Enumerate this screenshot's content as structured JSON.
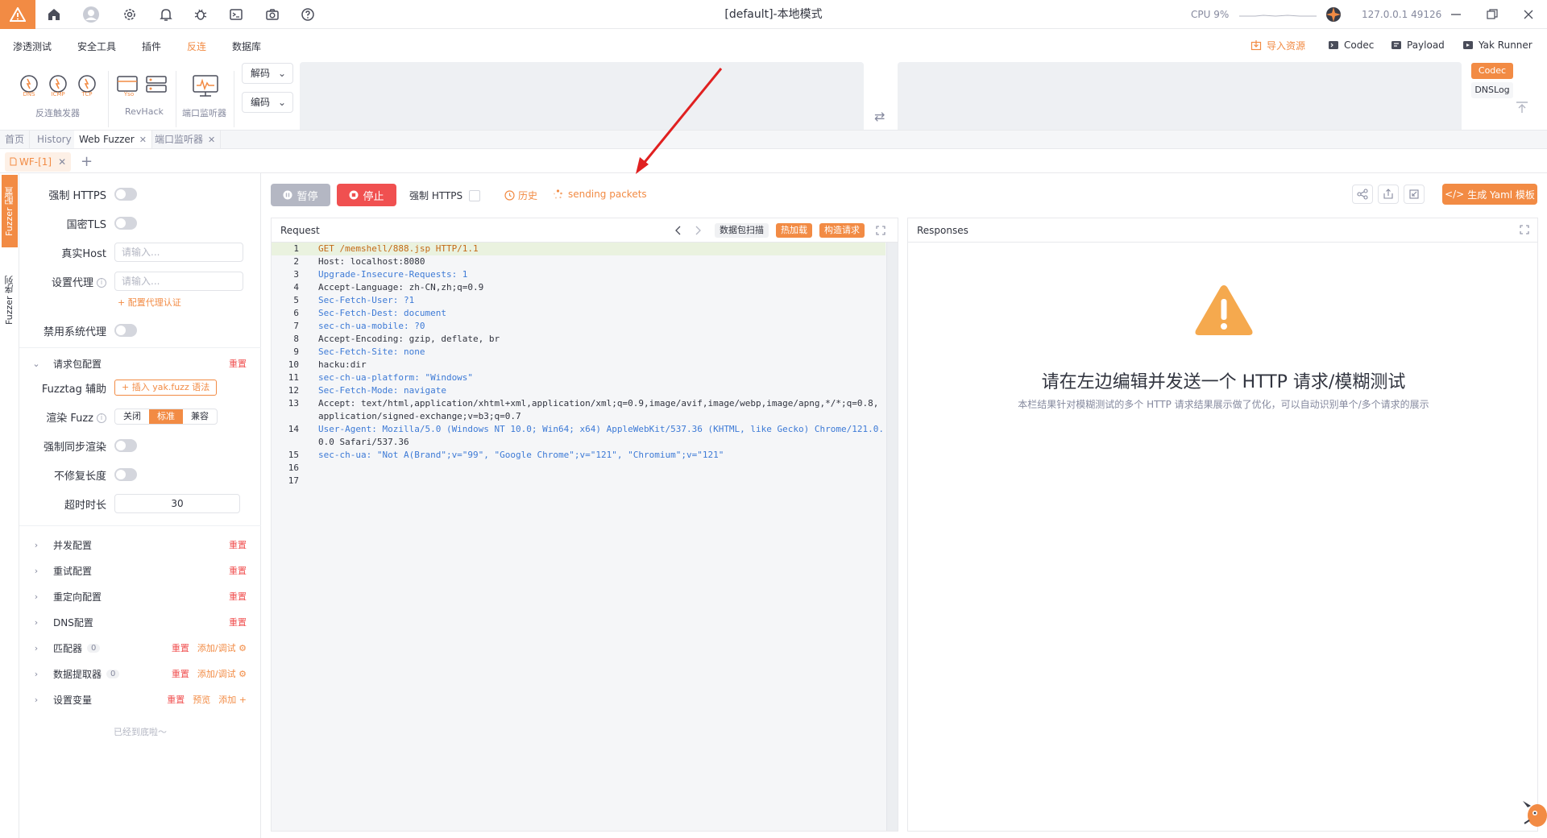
{
  "title_bar": {
    "window_title": "[default]-本地模式",
    "cpu_label": "CPU 9%",
    "address": "127.0.0.1 49126",
    "nav_icons": [
      "home-icon",
      "user-icon",
      "settings-icon",
      "bell-icon",
      "bug-icon",
      "terminal-icon",
      "camera-icon",
      "help-icon"
    ]
  },
  "menu": {
    "items": [
      "渗透测试",
      "安全工具",
      "插件",
      "反连",
      "数据库"
    ],
    "active": "反连",
    "right": {
      "import": "导入资源",
      "codec": "Codec",
      "payload": "Payload",
      "yak_runner": "Yak Runner"
    }
  },
  "tools": {
    "reverse_trigger": {
      "label": "反连触发器",
      "icons": [
        "DNS",
        "ICMP",
        "TCP"
      ]
    },
    "revhack": {
      "label": "RevHack"
    },
    "port_monitor": {
      "label": "端口监听器"
    },
    "decode": "解码",
    "encode": "编码",
    "right_tabs": [
      "Codec",
      "DNSLog"
    ]
  },
  "page_tabs": [
    {
      "label": "首页",
      "closable": false
    },
    {
      "label": "History",
      "closable": false
    },
    {
      "label": "Web Fuzzer",
      "closable": true,
      "active": true
    },
    {
      "label": "端口监听器",
      "closable": true
    }
  ],
  "sub_tabs": [
    {
      "label": "WF-[1]",
      "active": true
    }
  ],
  "vertical_tabs": [
    "Fuzzer 配置",
    "Fuzzer 序列"
  ],
  "config": {
    "force_https": "强制 HTTPS",
    "gm_tls": "国密TLS",
    "real_host": "真实Host",
    "real_host_placeholder": "请输入...",
    "proxy": "设置代理",
    "proxy_placeholder": "请输入...",
    "proxy_auth": "+ 配置代理认证",
    "disable_sys_proxy": "禁用系统代理",
    "request_config": "请求包配置",
    "reset": "重置",
    "fuzztag_helper": "Fuzztag 辅助",
    "insert_fuzz": "+ 插入 yak.fuzz 语法",
    "render_fuzz": "渲染 Fuzz",
    "render_options": [
      "关闭",
      "标准",
      "兼容"
    ],
    "render_selected": "标准",
    "sync_render": "强制同步渲染",
    "no_fix_length": "不修复长度",
    "timeout": "超时时长",
    "timeout_value": "30",
    "sections": [
      {
        "name": "并发配置",
        "actions": [
          "重置"
        ]
      },
      {
        "name": "重试配置",
        "actions": [
          "重置"
        ]
      },
      {
        "name": "重定向配置",
        "actions": [
          "重置"
        ]
      },
      {
        "name": "DNS配置",
        "actions": [
          "重置"
        ]
      },
      {
        "name": "匹配器",
        "count": "0",
        "actions": [
          "重置",
          "添加/调试"
        ]
      },
      {
        "name": "数据提取器",
        "count": "0",
        "actions": [
          "重置",
          "添加/调试"
        ]
      },
      {
        "name": "设置变量",
        "actions": [
          "重置",
          "预览",
          "添加"
        ]
      }
    ],
    "footer": "已经到底啦～"
  },
  "actions": {
    "pause": "暂停",
    "stop": "停止",
    "force_https": "强制 HTTPS",
    "history": "历史",
    "sending": "sending packets",
    "yaml": "生成 Yaml 模板"
  },
  "request": {
    "title": "Request",
    "scan_btn": "数据包扫描",
    "hot_load": "热加载",
    "build_req": "构造请求",
    "lines": [
      "GET /memshell/888.jsp HTTP/1.1",
      "Host: localhost:8080",
      "Upgrade-Insecure-Requests: 1",
      "Accept-Language: zh-CN,zh;q=0.9",
      "Sec-Fetch-User: ?1",
      "Sec-Fetch-Dest: document",
      "sec-ch-ua-mobile: ?0",
      "Accept-Encoding: gzip, deflate, br",
      "Sec-Fetch-Site: none",
      "hacku:dir",
      "sec-ch-ua-platform: \"Windows\"",
      "Sec-Fetch-Mode: navigate",
      "Accept: text/html,application/xhtml+xml,application/xml;q=0.9,image/avif,image/webp,image/apng,*/*;q=0.8,",
      "application/signed-exchange;v=b3;q=0.7",
      "User-Agent: Mozilla/5.0 (Windows NT 10.0; Win64; x64) AppleWebKit/537.36 (KHTML, like Gecko) Chrome/121.0.",
      "0.0 Safari/537.36",
      "sec-ch-ua: \"Not A(Brand\";v=\"99\", \"Google Chrome\";v=\"121\", \"Chromium\";v=\"121\"",
      "",
      ""
    ],
    "line_numbers": [
      "1",
      "2",
      "3",
      "4",
      "5",
      "6",
      "7",
      "8",
      "9",
      "10",
      "11",
      "12",
      "13",
      "",
      "14",
      "",
      "15",
      "16",
      "17"
    ]
  },
  "responses": {
    "title": "Responses",
    "empty_title": "请在左边编辑并发送一个 HTTP 请求/模糊测试",
    "empty_desc": "本栏结果针对模糊测试的多个 HTTP 请求结果展示做了优化，可以自动识别单个/多个请求的展示"
  },
  "colors": {
    "accent": "#f28b44",
    "danger": "#f05050",
    "key": "#3d7ad6",
    "annotation_arrow": "#e02020"
  }
}
